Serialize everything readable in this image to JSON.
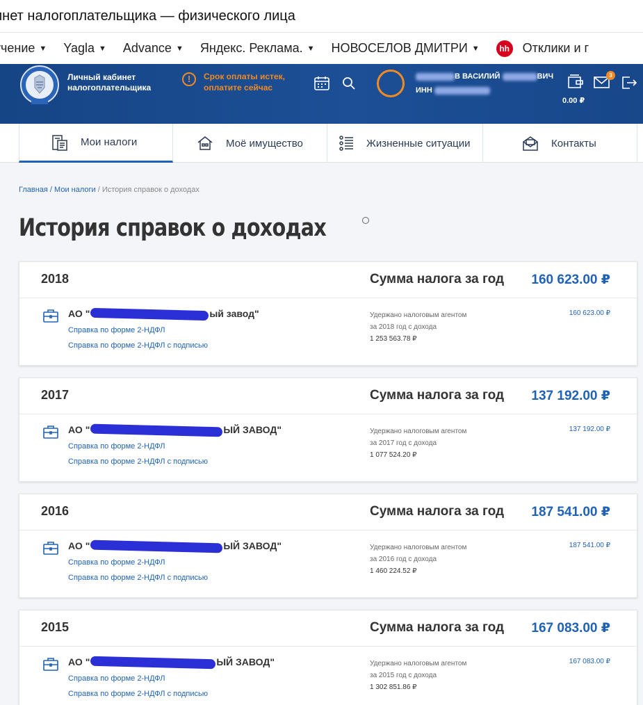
{
  "window": {
    "title": "инет налогоплательщика — физического лица"
  },
  "bookmarks": [
    {
      "label": "учение",
      "has_arrow": true
    },
    {
      "label": "Yagla",
      "has_arrow": true
    },
    {
      "label": "Advance",
      "has_arrow": true
    },
    {
      "label": "Яндекс. Реклама.",
      "has_arrow": true
    },
    {
      "label": "НОВОСЕЛОВ ДМИТРИ",
      "has_arrow": true
    },
    {
      "label": "Отклики и г",
      "icon": "hh",
      "has_arrow": false
    }
  ],
  "header": {
    "brand_line1": "Личный кабинет",
    "brand_line2": "налогоплательщика",
    "warning_icon": "!",
    "warning_line1": "Срок оплаты истек,",
    "warning_line2": "оплатите сейчас",
    "user_name_suffix": "В ВАСИЛИЙ",
    "user_name_end": "ВИЧ",
    "inn_label": "ИНН",
    "balance": "0.00 ₽",
    "mail_badge": "3",
    "accent_color": "#f08a24",
    "header_color": "#1a4a8f"
  },
  "tabs": [
    {
      "label": "Мои налоги",
      "icon": "taxes-icon",
      "active": true
    },
    {
      "label": "Моё имущество",
      "icon": "property-icon",
      "active": false
    },
    {
      "label": "Жизненные ситуации",
      "icon": "situations-icon",
      "active": false
    },
    {
      "label": "Контакты",
      "icon": "contacts-icon",
      "active": false
    }
  ],
  "breadcrumb": {
    "home": "Главная",
    "sep": " / ",
    "taxes": "Мои налоги",
    "current": "История справок о доходах"
  },
  "page_title": "История справок о доходах",
  "sum_label": "Сумма налога за год",
  "withheld_line1": "Удержано налоговым агентом",
  "link_ndfl": "Справка по форме 2-НДФЛ",
  "link_ndfl_signed": "Справка по форме 2-НДФЛ с подписью",
  "cards": [
    {
      "year": "2018",
      "sum": "160 623.00 ₽",
      "employer_prefix": "АО \"",
      "employer_suffix": "ый завод\"",
      "withheld_line2": "за 2018 год с дохода",
      "income": "1 253 563.78 ₽",
      "withheld": "160 623.00 ₽"
    },
    {
      "year": "2017",
      "sum": "137 192.00 ₽",
      "employer_prefix": "АО \"",
      "employer_suffix": "ЫЙ ЗАВОД\"",
      "withheld_line2": "за 2017 год с дохода",
      "income": "1 077 524.20 ₽",
      "withheld": "137 192.00 ₽"
    },
    {
      "year": "2016",
      "sum": "187 541.00 ₽",
      "employer_prefix": "АО \"",
      "employer_suffix": "ЫЙ ЗАВОД\"",
      "withheld_line2": "за 2016 год с дохода",
      "income": "1 460 224.52 ₽",
      "withheld": "187 541.00 ₽"
    },
    {
      "year": "2015",
      "sum": "167 083.00 ₽",
      "employer_prefix": "АО \"",
      "employer_suffix": "ЫЙ ЗАВОД\"",
      "withheld_line2": "за 2015 год с дохода",
      "income": "1 302 851.86 ₽",
      "withheld": "167 083.00 ₽"
    }
  ]
}
